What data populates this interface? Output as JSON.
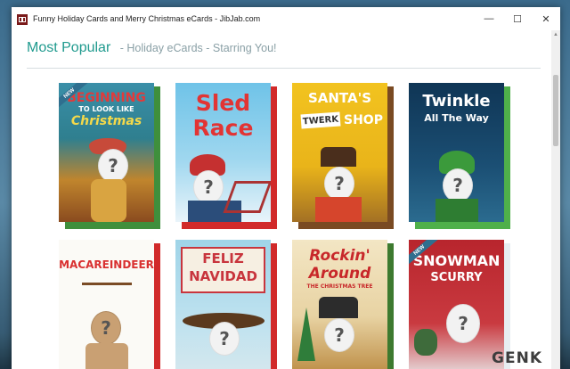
{
  "window": {
    "title": "Funny Holiday Cards and Merry Christmas eCards - JibJab.com"
  },
  "page": {
    "heading": "Most Popular",
    "subheading": "- Holiday eCards - Starring You!"
  },
  "cards": [
    {
      "line1": "BEGINNING",
      "line2": "TO LOOK LIKE",
      "line3": "Christmas",
      "new": true,
      "new_label": "NEW"
    },
    {
      "line1": "Sled",
      "line2": "Race"
    },
    {
      "line1": "SANTA'S",
      "line2": "TWERK",
      "line3": "SHOP"
    },
    {
      "line1": "Twinkle",
      "line2": "All The Way"
    },
    {
      "line1": "MACAREINDEER"
    },
    {
      "line1": "FELIZ",
      "line2": "NAVIDAD"
    },
    {
      "line1": "Rockin'",
      "line2": "Around",
      "line3": "THE CHRISTMAS TREE"
    },
    {
      "line1": "SNOWMAN",
      "line2": "SCURRY",
      "new": true,
      "new_label": "NEW"
    }
  ],
  "watermark": "GENK",
  "colors": {
    "accent": "#1f9a8e",
    "subtitle": "#8aa0a6"
  }
}
